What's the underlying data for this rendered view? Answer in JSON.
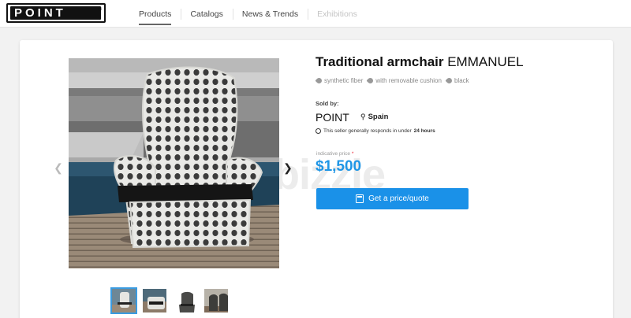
{
  "header": {
    "logo_text": "POINT",
    "nav": [
      {
        "label": "Products",
        "active": true
      },
      {
        "label": "Catalogs",
        "active": false
      },
      {
        "label": "News & Trends",
        "active": false
      },
      {
        "label": "Exhibitions",
        "active": false,
        "muted": true
      }
    ]
  },
  "product": {
    "title_bold": "Traditional armchair",
    "title_rest": " EMMANUEL",
    "tags": [
      "synthetic fiber",
      "with removable cushion",
      "black"
    ],
    "sold_by_label": "Sold by:",
    "seller_name": "POINT",
    "seller_location": "Spain",
    "response_text": "This seller generally responds in under",
    "response_time": "24 hours",
    "price_label": "indicative price",
    "price_required_mark": "*",
    "price": "$1,500",
    "quote_button": "Get a price/quote"
  },
  "gallery": {
    "thumbnail_count": 4,
    "active_thumbnail": 1
  },
  "watermark": "dubizzle",
  "colors": {
    "accent": "#1a91e8",
    "price": "#1f96e6",
    "thumb_active_border": "#3a9be0"
  }
}
